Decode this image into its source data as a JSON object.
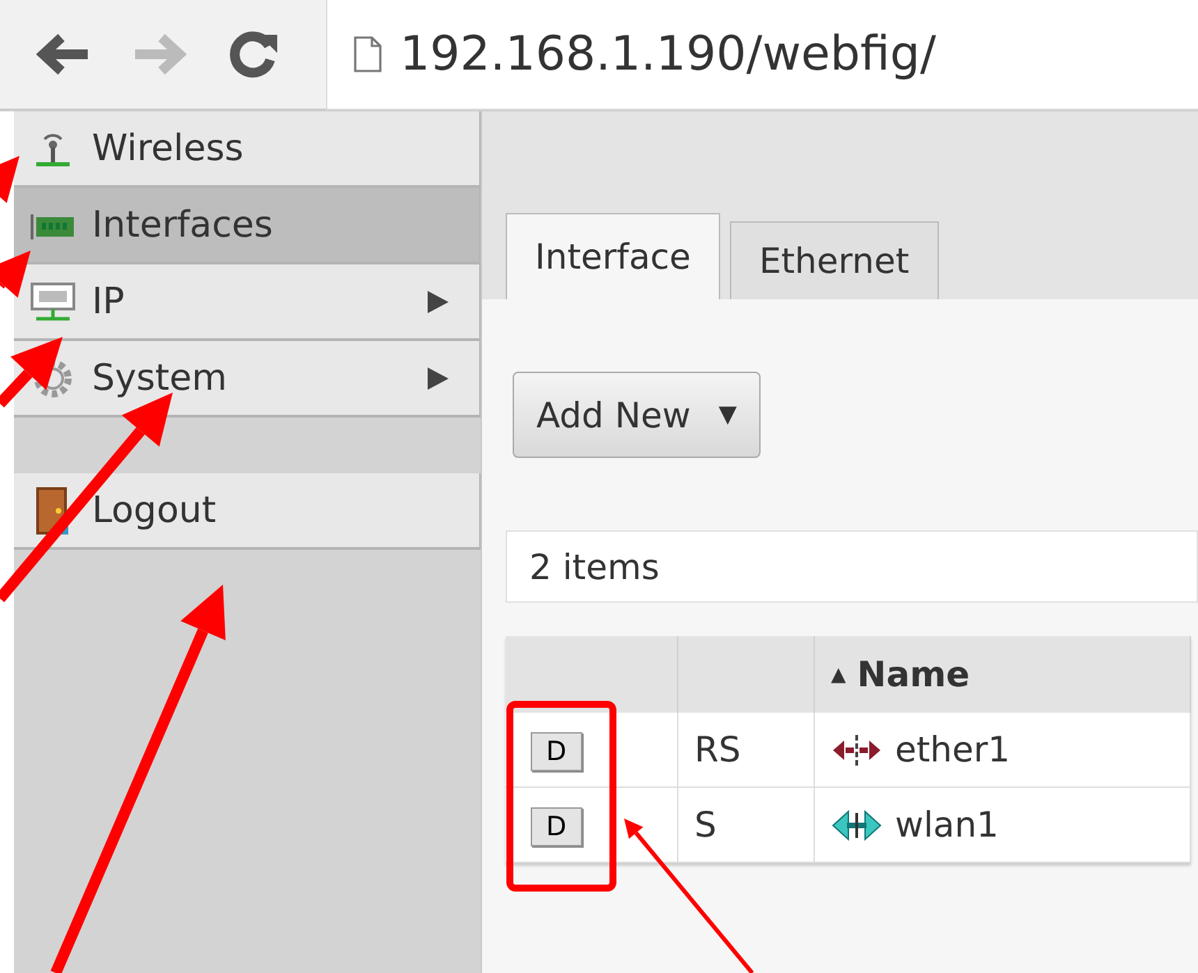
{
  "browser": {
    "back_enabled": true,
    "forward_enabled": false,
    "url": "192.168.1.190/webfig/"
  },
  "sidebar": {
    "groups": [
      [
        {
          "label": "Wireless",
          "kind": "wireless",
          "selected": false,
          "submenu": false
        },
        {
          "label": "Interfaces",
          "kind": "interfaces",
          "selected": true,
          "submenu": false
        },
        {
          "label": "IP",
          "kind": "ip",
          "selected": false,
          "submenu": true
        },
        {
          "label": "System",
          "kind": "system",
          "selected": false,
          "submenu": true
        }
      ],
      [
        {
          "label": "Logout",
          "kind": "logout",
          "selected": false,
          "submenu": false
        }
      ]
    ]
  },
  "tabs": [
    {
      "label": "Interface",
      "selected": true
    },
    {
      "label": "Ethernet",
      "selected": false
    }
  ],
  "add_button": {
    "label": "Add New",
    "caret": "▼"
  },
  "item_count": "2 items",
  "table": {
    "columns": [
      {
        "label": "Name",
        "sort_mark": "▲"
      }
    ],
    "rows": [
      {
        "toggle": "D",
        "flags": "RS",
        "kind": "ethernet",
        "name": "ether1"
      },
      {
        "toggle": "D",
        "flags": "S",
        "kind": "wireless",
        "name": "wlan1"
      }
    ]
  }
}
